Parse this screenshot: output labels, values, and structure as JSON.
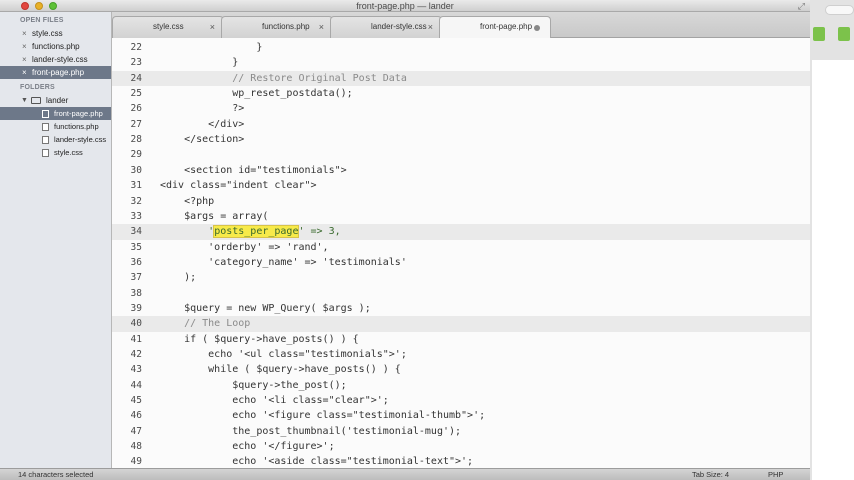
{
  "window": {
    "title": "front-page.php — lander"
  },
  "sidebar": {
    "open_files_header": "OPEN FILES",
    "open_files": [
      {
        "label": "style.css"
      },
      {
        "label": "functions.php"
      },
      {
        "label": "lander-style.css"
      },
      {
        "label": "front-page.php",
        "active": true
      }
    ],
    "folders_header": "FOLDERS",
    "folder_name": "lander",
    "folder_files": [
      {
        "label": "front-page.php",
        "active": true
      },
      {
        "label": "functions.php"
      },
      {
        "label": "lander-style.css"
      },
      {
        "label": "style.css"
      }
    ]
  },
  "tabs": [
    {
      "label": "style.css"
    },
    {
      "label": "functions.php"
    },
    {
      "label": "lander-style.css"
    },
    {
      "label": "front-page.php",
      "active": true
    }
  ],
  "editor": {
    "lines": [
      {
        "num": "22",
        "code": "                }"
      },
      {
        "num": "23",
        "code": "            }"
      },
      {
        "num": "24",
        "code": "            // Restore Original Post Data",
        "comment": true,
        "current": true
      },
      {
        "num": "25",
        "code": "            wp_reset_postdata();"
      },
      {
        "num": "26",
        "code": "            ?>"
      },
      {
        "num": "27",
        "code": "        </div>"
      },
      {
        "num": "28",
        "code": "    </section>"
      },
      {
        "num": "29",
        "code": ""
      },
      {
        "num": "30",
        "code": "    <section id=\"testimonials\">"
      },
      {
        "num": "31",
        "code": "<div class=\"indent clear\">"
      },
      {
        "num": "32",
        "code": "    <?php"
      },
      {
        "num": "33",
        "code": "    $args = array("
      },
      {
        "num": "34",
        "pre": "        '",
        "selected": "posts_per_page",
        "post": "' => 3,",
        "current": true
      },
      {
        "num": "35",
        "code": "        'orderby' => 'rand',"
      },
      {
        "num": "36",
        "code": "        'category_name' => 'testimonials'"
      },
      {
        "num": "37",
        "code": "    );"
      },
      {
        "num": "38",
        "code": ""
      },
      {
        "num": "39",
        "code": "    $query = new WP_Query( $args );"
      },
      {
        "num": "40",
        "code": "    // The Loop",
        "comment": true,
        "current": true
      },
      {
        "num": "41",
        "code": "    if ( $query->have_posts() ) {"
      },
      {
        "num": "42",
        "code": "        echo '<ul class=\"testimonials\">';"
      },
      {
        "num": "43",
        "code": "        while ( $query->have_posts() ) {"
      },
      {
        "num": "44",
        "code": "            $query->the_post();"
      },
      {
        "num": "45",
        "code": "            echo '<li class=\"clear\">';"
      },
      {
        "num": "46",
        "code": "            echo '<figure class=\"testimonial-thumb\">';"
      },
      {
        "num": "47",
        "code": "            the_post_thumbnail('testimonial-mug');"
      },
      {
        "num": "48",
        "code": "            echo '</figure>';"
      },
      {
        "num": "49",
        "code": "            echo '<aside class=\"testimonial-text\">';"
      }
    ]
  },
  "status": {
    "selection": "14 characters selected",
    "tab_size": "Tab Size: 4",
    "syntax": "PHP"
  },
  "colors": {
    "selection": "#f7ea49",
    "sidebar_active": "#6d7889",
    "comment": "#8a8a8a"
  }
}
